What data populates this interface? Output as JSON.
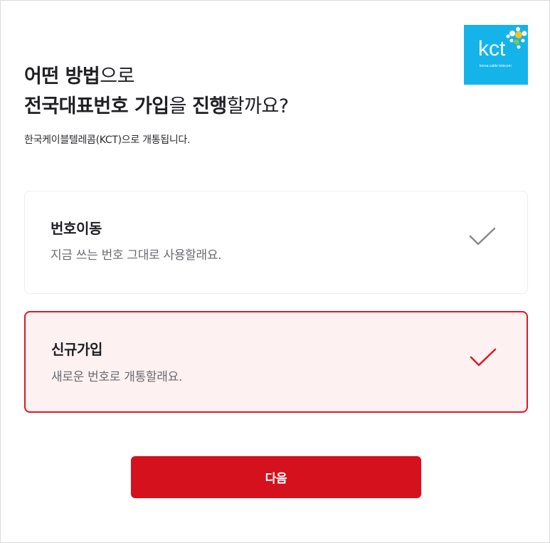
{
  "logo": {
    "text": "kct",
    "subtext": "korea cable telecom",
    "bg_color": "#14b4ea"
  },
  "heading": {
    "line1_bold": "어떤 방법",
    "line1_rest": "으로",
    "line2_bold_a": "전국대표번호 가입",
    "line2_mid": "을 ",
    "line2_bold_b": "진행",
    "line2_rest": "할까요?"
  },
  "subtitle": "한국케이블텔레콤(KCT)으로 개통됩니다.",
  "options": [
    {
      "title": "번호이동",
      "description": "지금 쓰는 번호 그대로 사용할래요.",
      "selected": false,
      "check_color": "#8a8a8a"
    },
    {
      "title": "신규가입",
      "description": "새로운 번호로 개통할래요.",
      "selected": true,
      "check_color": "#d71a28"
    }
  ],
  "next_button": {
    "label": "다음",
    "color": "#d4111c"
  }
}
